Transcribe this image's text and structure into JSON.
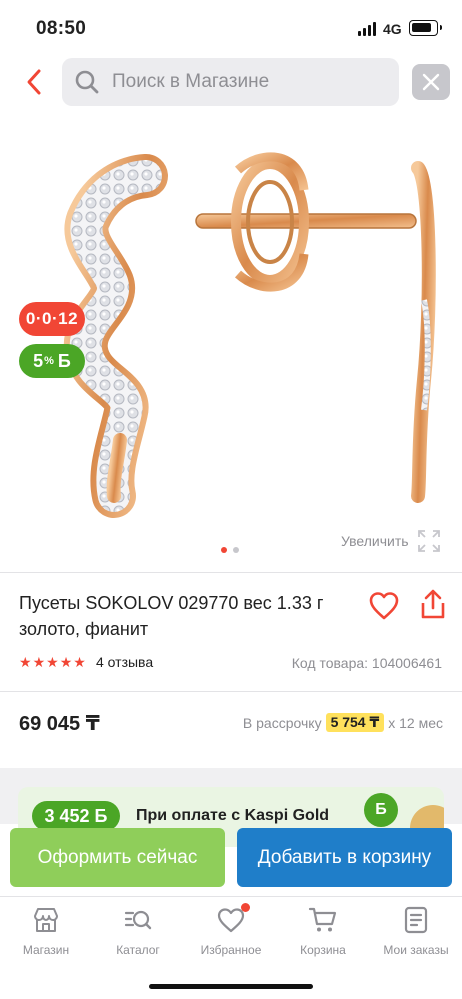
{
  "status_bar": {
    "time": "08:50",
    "network": "4G"
  },
  "search": {
    "placeholder": "Поиск в Магазине"
  },
  "icons": {
    "back": "chevron-left-icon",
    "search": "search-icon",
    "clear": "close-icon",
    "favorite": "heart-icon",
    "share": "share-icon",
    "zoom": "expand-icon"
  },
  "badges": {
    "promo": "0·0·12",
    "bonus_percent": "5",
    "bonus_suffix": "%",
    "bonus_symbol": "Б"
  },
  "gallery": {
    "zoom_label": "Увеличить",
    "pages": 2,
    "active_page": 1
  },
  "product": {
    "title": "Пусеты SOKOLOV 029770 вес 1.33 г золото, фианит",
    "rating": 5,
    "reviews": "4 отзыва",
    "sku": "Код товара: 104006461",
    "price": "69 045 ₸",
    "installment_prefix": "В рассрочку",
    "installment_amount": "5 754 ₸",
    "installment_suffix": "x 12 мес"
  },
  "kaspi_banner": {
    "bonus": "3 452 Б",
    "text": "При оплате с Kaspi Gold",
    "coin": "Б"
  },
  "actions": {
    "buy_now": "Оформить сейчас",
    "add_to_cart": "Добавить в корзину"
  },
  "tabbar": [
    {
      "label": "Магазин",
      "icon": "store-icon"
    },
    {
      "label": "Каталог",
      "icon": "catalog-search-icon"
    },
    {
      "label": "Избранное",
      "icon": "heart-icon",
      "has_dot": true
    },
    {
      "label": "Корзина",
      "icon": "cart-icon"
    },
    {
      "label": "Мои заказы",
      "icon": "orders-icon"
    }
  ],
  "colors": {
    "accent_red": "#f14635",
    "bonus_green": "#4ba626",
    "buy_now_green": "#8fce5a",
    "cart_blue": "#1f7ec9",
    "installment_highlight": "#ffe15c"
  }
}
